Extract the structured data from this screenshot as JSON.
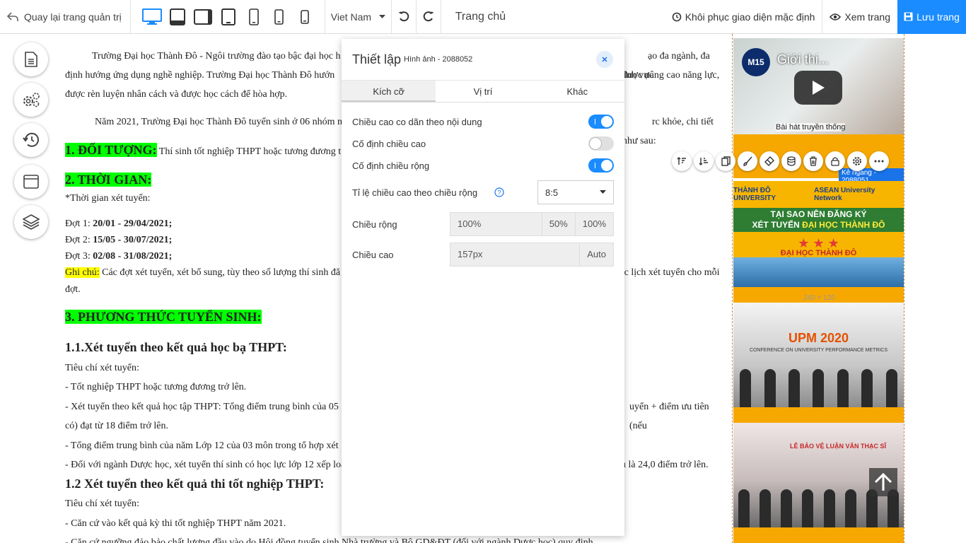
{
  "toolbar": {
    "back_label": "Quay lại trang quản trị",
    "language": "Viet Nam",
    "page_name": "Trang chủ",
    "restore_label": "Khôi phục giao diện mặc định",
    "view_label": "Xem trang",
    "save_label": "Lưu trang",
    "devices": [
      "desktop-icon",
      "tablet-landscape-icon",
      "tablet-wide-icon",
      "tablet-icon",
      "phone-large-icon",
      "phone-icon",
      "phone-small-icon"
    ],
    "accent_color": "#1a8cff"
  },
  "document": {
    "p1_line1": "Trường Đại học Thành Đô - Ngôi trường đào tạo bậc đại học h",
    "p1_line1_tail": "ạo đa ngành, đa lĩnh vực",
    "p1_line2": "định hướng ứng dụng nghề nghiệp. Trường Đại học Thành Đô hướn",
    "p1_line2_tail": "được nâng cao năng lực,",
    "p1_line3": "được rèn luyện nhân cách và được học cách để hòa hợp.",
    "p2": "Năm 2021, Trường Đại học Thành Đô tuyển sinh ở 06 nhóm n",
    "p2_tail": "rc khỏe, chi tiết như sau:",
    "sec1_heading": "1. ĐỐI TƯỢNG:",
    "sec1_text": "Thí sinh tốt nghiệp THPT hoặc tương đương t",
    "sec2_heading": "2. THỜI GIAN:",
    "time_label": "*Thời gian xét tuyển:",
    "rounds": [
      {
        "label": "Đợt 1: ",
        "dates": "20/01 - 29/04/2021;"
      },
      {
        "label": "Đợt 2: ",
        "dates": "15/05 - 30/07/2021;"
      },
      {
        "label": "Đợt 3: ",
        "dates": "02/08 - 31/08/2021;"
      }
    ],
    "note_label": "Ghi chú:",
    "note_text": " Các đợt xét tuyển, xét bổ sung, tùy theo số lượng thí sinh đă",
    "note_tail": "rc lịch xét tuyển cho mỗi",
    "note_line2": "đợt.",
    "sec3_heading": "3. PHƯƠNG THỨC TUYỂN SINH:",
    "sub1_heading": "1.1.Xét tuyển theo kết quả học bạ THPT:",
    "criteria_label": "Tiêu chí xét tuyển:",
    "sub1_items": [
      "- Tốt nghiệp THPT hoặc tương đương trở lên.",
      "- Xét tuyển theo kết quả học tập THPT: Tổng điểm trung bình của 05",
      "có) đạt từ 18 điểm trở lên.",
      "- Tổng điểm trung bình của năm Lớp 12 của 03 môn trong tổ hợp xét",
      "- Đối với ngành Dược học, xét tuyển thí sinh có học lực lớp 12 xếp loạ"
    ],
    "sub1_item2_tail": "uyển + điểm ưu tiên (nếu",
    "sub1_item5_tail": "u là 24,0 điểm trở lên.",
    "sub2_heading": "1.2 Xét tuyển theo kết quả thi tốt nghiệp THPT:",
    "criteria_label_2": "Tiêu chí xét tuyển:",
    "sub2_items": [
      "- Căn cứ vào kết quả kỳ thi tốt nghiệp THPT năm 2021.",
      "- Căn cứ ngưỡng đảo bảo chất lượng đầu vào do Hội đồng tuyển sinh Nhà trường và Bộ GD&ĐT (đối với ngành Dược học) quy định."
    ]
  },
  "side_buttons": [
    "document-icon",
    "settings-gears-icon",
    "history-icon",
    "window-icon",
    "layers-icon"
  ],
  "right_column": {
    "video_title": "Giới thi...",
    "video_badge": "M15",
    "video_caption": "Bài hát truyền thống",
    "selection_label": "Kẻ ngang - 2088051",
    "banner_logo_left": "THÀNH ĐÔ UNIVERSITY",
    "banner_logo_right": "ASEAN University Network",
    "banner_line1": "TẠI SAO NÊN ĐĂNG KÝ",
    "banner_line2": "XÉT TUYỂN",
    "banner_line2_hl": "ĐẠI HỌC THÀNH ĐÔ",
    "banner_stars": "★ ★ ★",
    "banner_uni": "ĐẠI HỌC THÀNH ĐÔ",
    "size_label": "240 × 120",
    "photo1_title": "UPM 2020",
    "photo1_sub": "CONFERENCE ON UNIVERSITY PERFORMANCE METRICS",
    "photo2_title": "LỄ BẢO VỆ LUẬN VĂN THẠC SĨ"
  },
  "element_tools": [
    "sort-up-icon",
    "sort-down-icon",
    "copy-icon",
    "brush-icon",
    "eraser-icon",
    "database-icon",
    "trash-icon",
    "lock-icon",
    "gear-icon",
    "more-icon"
  ],
  "panel": {
    "title": "Thiết lập",
    "subtitle": "Hình ảnh - 2088052",
    "tabs": [
      "Kích cỡ",
      "Vị trí",
      "Khác"
    ],
    "active_tab": "Kích cỡ",
    "toggles": [
      {
        "label": "Chiều cao co dãn theo nội dung",
        "on": true
      },
      {
        "label": "Cố định chiều cao",
        "on": false
      },
      {
        "label": "Cố định chiều rộng",
        "on": true
      }
    ],
    "ratio_label": "Tỉ lệ chiều cao theo chiều rộng",
    "ratio_value": "8:5",
    "width_label": "Chiều rộng",
    "width_value": "100%",
    "width_opt1": "50%",
    "width_opt2": "100%",
    "height_label": "Chiều cao",
    "height_value": "157px",
    "height_opt": "Auto"
  }
}
